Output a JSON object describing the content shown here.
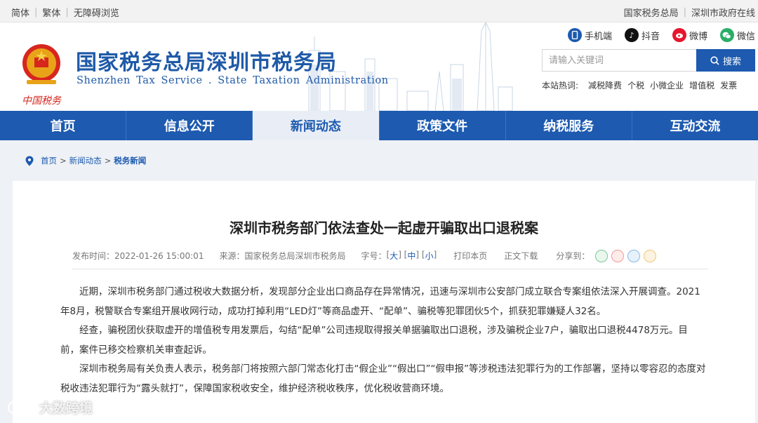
{
  "topbar": {
    "left": [
      "简体",
      "繁体",
      "无障碍浏览"
    ],
    "right": [
      "国家税务总局",
      "深圳市政府在线"
    ]
  },
  "header": {
    "title": "国家税务总局深圳市税务局",
    "subtitle": "Shenzhen Tax Service . State Taxation Administration",
    "logo_text": "中国税务",
    "social": [
      {
        "label": "手机端",
        "icon": "mobile-icon",
        "color": "#1d5ab0"
      },
      {
        "label": "抖音",
        "icon": "douyin-icon",
        "color": "#111111"
      },
      {
        "label": "微博",
        "icon": "weibo-icon",
        "color": "#e6162d"
      },
      {
        "label": "微信",
        "icon": "wechat-icon",
        "color": "#2aae67"
      }
    ],
    "search": {
      "placeholder": "请输入关键词",
      "button": "搜索"
    },
    "hot": {
      "label": "本站热词:",
      "keywords": [
        "减税降费",
        "个税",
        "小微企业",
        "增值税",
        "发票"
      ]
    }
  },
  "nav": {
    "tabs": [
      "首页",
      "信息公开",
      "新闻动态",
      "政策文件",
      "纳税服务",
      "互动交流"
    ],
    "active": "新闻动态"
  },
  "breadcrumb": {
    "items": [
      "首页",
      "新闻动态",
      "税务新闻"
    ],
    "sep": ">"
  },
  "article": {
    "title": "深圳市税务部门依法查处一起虚开骗取出口退税案",
    "meta": {
      "date": "发布时间：2022-01-26 15:00:01",
      "source": "来源：国家税务总局深圳市税务局",
      "size_label": "字号：",
      "sizes": [
        "大",
        "中",
        "小"
      ],
      "print": "打印本页",
      "download": "正文下载",
      "share": "分享到："
    },
    "paragraphs": [
      "近期，深圳市税务部门通过税收大数据分析，发现部分企业出口商品存在异常情况，迅速与深圳市公安部门成立联合专案组依法深入开展调查。2021年8月，税警联合专案组开展收网行动，成功打掉利用“LED灯”等商品虚开、“配单”、骗税等犯罪团伙5个，抓获犯罪嫌疑人32名。",
      "经查，骗税团伙获取虚开的增值税专用发票后，勾结“配单”公司违规取得报关单据骗取出口退税，涉及骗税企业7户，骗取出口退税4478万元。目前，案件已移交检察机关审查起诉。",
      "深圳市税务局有关负责人表示，税务部门将按照六部门常态化打击“假企业”“假出口”“假申报”等涉税违法犯罪行为的工作部署，坚持以零容忍的态度对税收违法犯罪行为“露头就打”，保障国家税收安全，维护经济税收秩序，优化税收营商环境。"
    ]
  },
  "watermark": "大数跨境",
  "colors": {
    "primary": "#1d5ab0",
    "background": "#eef1f5"
  }
}
